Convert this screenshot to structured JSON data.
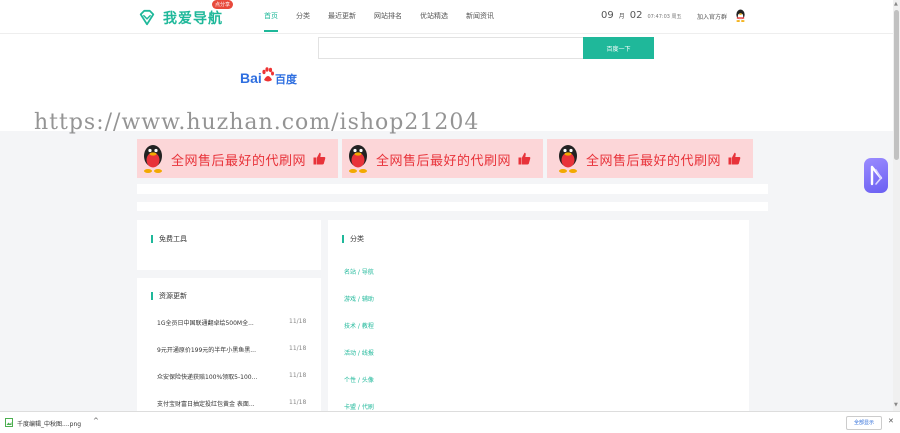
{
  "header": {
    "logo_text": "我爱导航",
    "logo_badge": "点分享",
    "nav": [
      {
        "label": "首页",
        "active": true
      },
      {
        "label": "分类",
        "active": false
      },
      {
        "label": "最近更新",
        "active": false
      },
      {
        "label": "网站排名",
        "active": false
      },
      {
        "label": "优站精选",
        "active": false
      },
      {
        "label": "新闻资讯",
        "active": false
      }
    ],
    "date": {
      "month": "09",
      "month_unit": "月",
      "day": "02",
      "time": "07:47:03 周五"
    },
    "join_group": "加入官方群"
  },
  "search": {
    "engine_bai": "Bai",
    "engine_du": "百度",
    "input_value": "",
    "button_label": "百度一下"
  },
  "watermark": "https://www.huzhan.com/ishop21204",
  "banners": [
    {
      "text": "全网售后最好的代刷网"
    },
    {
      "text": "全网售后最好的代刷网"
    },
    {
      "text": "全网售后最好的代刷网"
    }
  ],
  "free_tools": {
    "title": "免费工具"
  },
  "resources": {
    "title": "资源更新",
    "items": [
      {
        "title": "1G全员日中国联通翻卓绘500M全...",
        "date": "11/18"
      },
      {
        "title": "9元开通原价199元的半年小黑鱼黑...",
        "date": "11/18"
      },
      {
        "title": "众安保险快递获赔100%领取5-100...",
        "date": "11/18"
      },
      {
        "title": "支付宝财富日抽定投红包黄金 表面...",
        "date": "11/18"
      }
    ]
  },
  "categories": {
    "title": "分类",
    "items": [
      "名站 / 导航",
      "游戏 / 辅助",
      "技术 / 教程",
      "活动 / 线报",
      "个性 / 头像",
      "卡盟 / 代刷"
    ]
  },
  "download_bar": {
    "filename": "千度编辑_中秋图....png",
    "show_all": "全部显示"
  },
  "colors": {
    "accent": "#1fb89a",
    "banner_bg": "#fcd6d8",
    "banner_text": "#e8333a",
    "baidu_blue": "#2f6fe0"
  },
  "icons": {
    "logo": "diamond-logo-icon",
    "qq": "qq-penguin-icon",
    "thumb": "thumbs-up-icon",
    "float": "floating-app-icon",
    "file": "image-file-icon"
  }
}
